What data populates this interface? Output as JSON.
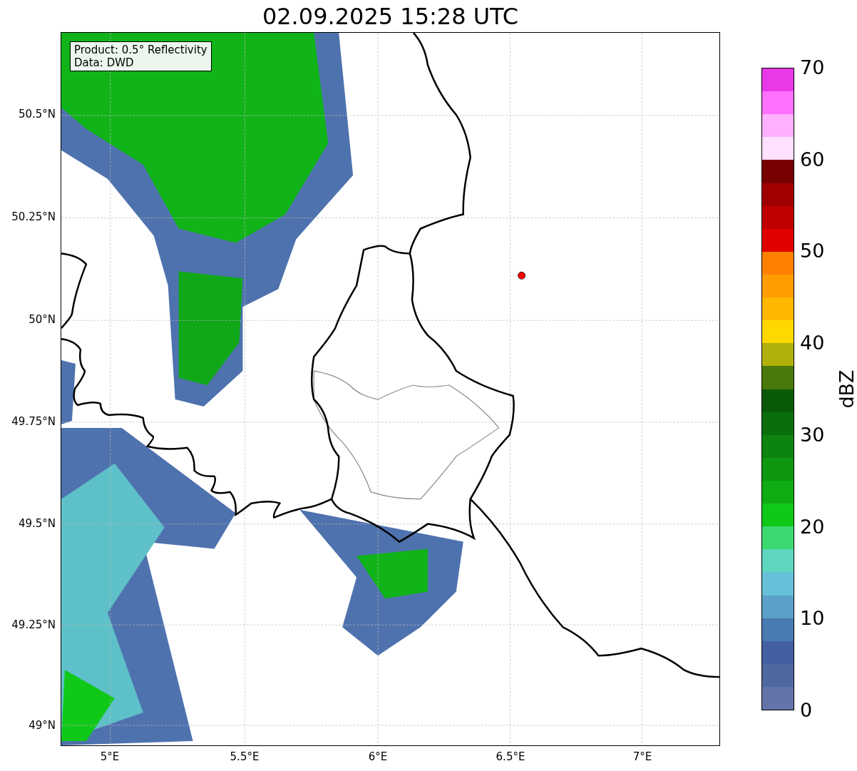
{
  "title": "02.09.2025 15:28 UTC",
  "info_box": {
    "lines": [
      "Product: 0.5° Reflectivity",
      "Data: DWD"
    ]
  },
  "map": {
    "lat_labels": [
      "50.5°N",
      "50.25°N",
      "50°N",
      "49.75°N",
      "49.5°N",
      "49.25°N",
      "49°N"
    ],
    "lon_labels": [
      "5°E",
      "5.5°E",
      "6°E",
      "6.5°E",
      "7°E"
    ]
  },
  "colorbar": {
    "label": "dBZ",
    "ticks": [
      "70",
      "60",
      "50",
      "40",
      "30",
      "20",
      "10",
      "0"
    ],
    "segments": [
      {
        "color": "#e838e8"
      },
      {
        "color": "#ff70ff"
      },
      {
        "color": "#ffb0ff"
      },
      {
        "color": "#ffe0ff"
      },
      {
        "color": "#780000"
      },
      {
        "color": "#a00000"
      },
      {
        "color": "#c00000"
      },
      {
        "color": "#e00000"
      },
      {
        "color": "#ff8000"
      },
      {
        "color": "#ff9c00"
      },
      {
        "color": "#ffb800"
      },
      {
        "color": "#ffd800"
      },
      {
        "color": "#b0b00a"
      },
      {
        "color": "#4a780a"
      },
      {
        "color": "#0a5a0a"
      },
      {
        "color": "#0a6e0c"
      },
      {
        "color": "#0c840e"
      },
      {
        "color": "#0e9810"
      },
      {
        "color": "#10ac14"
      },
      {
        "color": "#10c818"
      },
      {
        "color": "#3cd870"
      },
      {
        "color": "#5ed6c0"
      },
      {
        "color": "#66c0d8"
      },
      {
        "color": "#5aa0c8"
      },
      {
        "color": "#4a7ab2"
      },
      {
        "color": "#4460a4"
      },
      {
        "color": "#5068a0"
      },
      {
        "color": "#6374a8"
      }
    ]
  }
}
